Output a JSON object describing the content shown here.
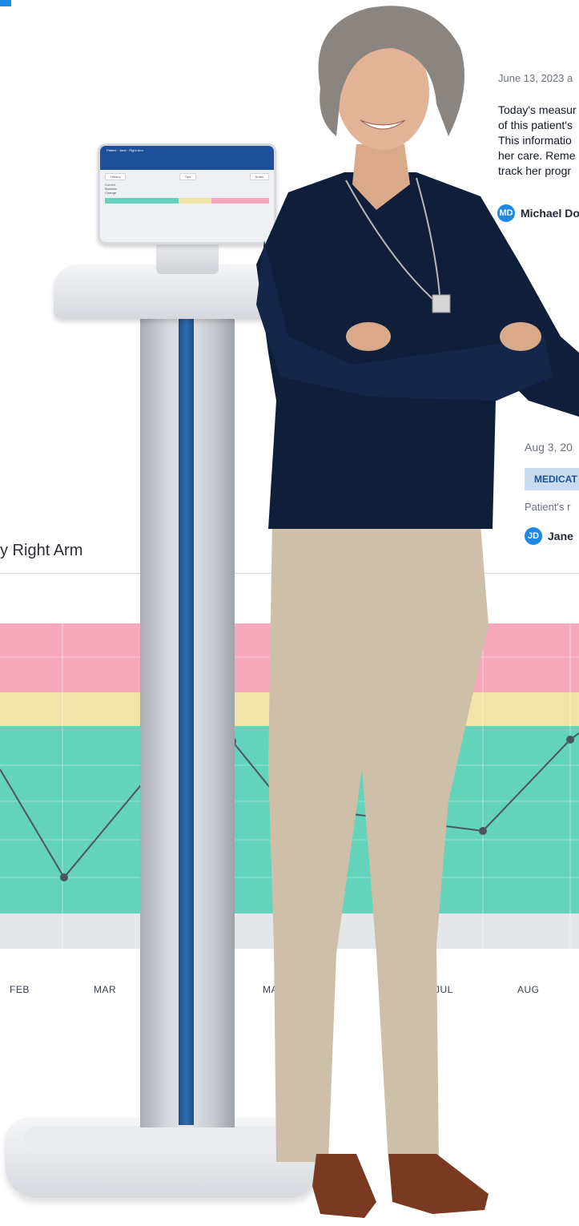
{
  "chart": {
    "title": "y Right Arm",
    "months": [
      "FEB",
      "MAR",
      "MA",
      "JUL",
      "AUG"
    ],
    "colors": {
      "normal": "#63d3bb",
      "caution": "#f2e3a8",
      "alert": "#f7a8bd",
      "low": "#e4e6ea",
      "line": "#4b5563"
    }
  },
  "notes": [
    {
      "date": "June 13, 2023 a",
      "body_lines": [
        "Today's measur",
        "of this patient's",
        "This informatio",
        "her care. Reme",
        "track her progr"
      ],
      "author_initials": "MD",
      "author_name": "Michael Do"
    },
    {
      "date": "Aug 3, 20",
      "badge": "MEDICAT",
      "text": "Patient's r",
      "author_initials": "JD",
      "author_name": "Jane"
    }
  ],
  "tablet": {
    "header": "Patient · Jane · Right Arm",
    "buttons": [
      "History",
      "Tips",
      "Notes"
    ],
    "rows": [
      "Current",
      "Baseline",
      "Change"
    ]
  },
  "brand_color": "#1e88e5"
}
